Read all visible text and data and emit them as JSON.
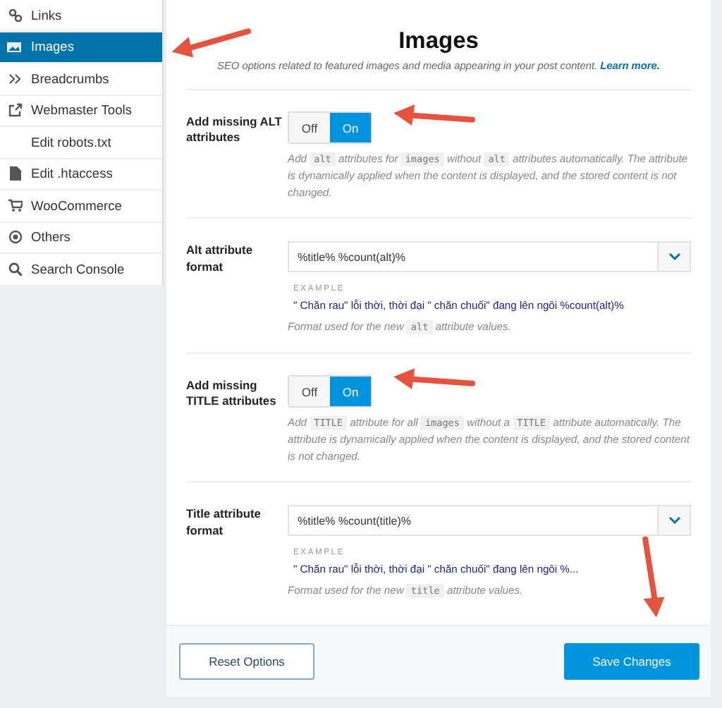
{
  "sidebar": {
    "items": [
      {
        "label": "Links",
        "selected": false,
        "annotated": false
      },
      {
        "label": "Images",
        "selected": true,
        "annotated": true
      },
      {
        "label": "Breadcrumbs",
        "selected": false,
        "annotated": false
      },
      {
        "label": "Webmaster Tools",
        "selected": false,
        "annotated": false
      },
      {
        "label": "Edit robots.txt",
        "selected": false,
        "annotated": false
      },
      {
        "label": "Edit .htaccess",
        "selected": false,
        "annotated": false
      },
      {
        "label": "WooCommerce",
        "selected": false,
        "annotated": false
      },
      {
        "label": "Others",
        "selected": false,
        "annotated": false
      },
      {
        "label": "Search Console",
        "selected": false,
        "annotated": false
      }
    ]
  },
  "panel": {
    "title": "Images",
    "subtitle": "SEO options related to featured images and media appearing in your post content.",
    "subtitle_link": "Learn more.",
    "settings": [
      {
        "kind": "toggle",
        "label": "Add missing ALT attributes",
        "options": [
          {
            "label": "Off",
            "selected": false
          },
          {
            "label": "On",
            "selected": true
          }
        ],
        "annotated": true,
        "description": [
          {
            "kind": "text",
            "text": "Add "
          },
          {
            "kind": "code",
            "text": "alt"
          },
          {
            "kind": "text",
            "text": " attributes for "
          },
          {
            "kind": "code",
            "text": "images"
          },
          {
            "kind": "text",
            "text": " without "
          },
          {
            "kind": "code",
            "text": "alt"
          },
          {
            "kind": "text",
            "text": " attributes automatically. The attribute is dynamically applied when the content is displayed, and the stored content is not changed."
          }
        ]
      },
      {
        "kind": "select",
        "label": "Alt attribute format",
        "value": "%title% %count(alt)%",
        "example_label": "EXAMPLE",
        "example": "\" Chăn rau\" lỗi thời, thời đại \" chăn chuối\" đang lên ngôi %count(alt)%",
        "description": [
          {
            "kind": "text",
            "text": "Format used for the new "
          },
          {
            "kind": "code",
            "text": "alt"
          },
          {
            "kind": "text",
            "text": " attribute values."
          }
        ]
      },
      {
        "kind": "toggle",
        "label": "Add missing TITLE attributes",
        "options": [
          {
            "label": "Off",
            "selected": false
          },
          {
            "label": "On",
            "selected": true
          }
        ],
        "annotated": true,
        "description": [
          {
            "kind": "text",
            "text": "Add "
          },
          {
            "kind": "code",
            "text": "TITLE"
          },
          {
            "kind": "text",
            "text": " attribute for all "
          },
          {
            "kind": "code",
            "text": "images"
          },
          {
            "kind": "text",
            "text": " without a "
          },
          {
            "kind": "code",
            "text": "TITLE"
          },
          {
            "kind": "text",
            "text": " attribute automatically. The attribute is dynamically applied when the content is displayed, and the stored content is not changed."
          }
        ]
      },
      {
        "kind": "select",
        "label": "Title attribute format",
        "value": "%title% %count(title)%",
        "example_label": "EXAMPLE",
        "example": "\" Chăn rau\" lỗi thời, thời đại \" chăn chuối\" đang lên ngôi %...",
        "description": [
          {
            "kind": "text",
            "text": "Format used for the new "
          },
          {
            "kind": "code",
            "text": "title"
          },
          {
            "kind": "text",
            "text": " attribute values."
          }
        ]
      }
    ]
  },
  "footer": {
    "buttons": [
      {
        "label": "Reset Options",
        "kind": "secondary",
        "annotated": false
      },
      {
        "label": "Save Changes",
        "kind": "primary",
        "annotated": true
      }
    ]
  }
}
